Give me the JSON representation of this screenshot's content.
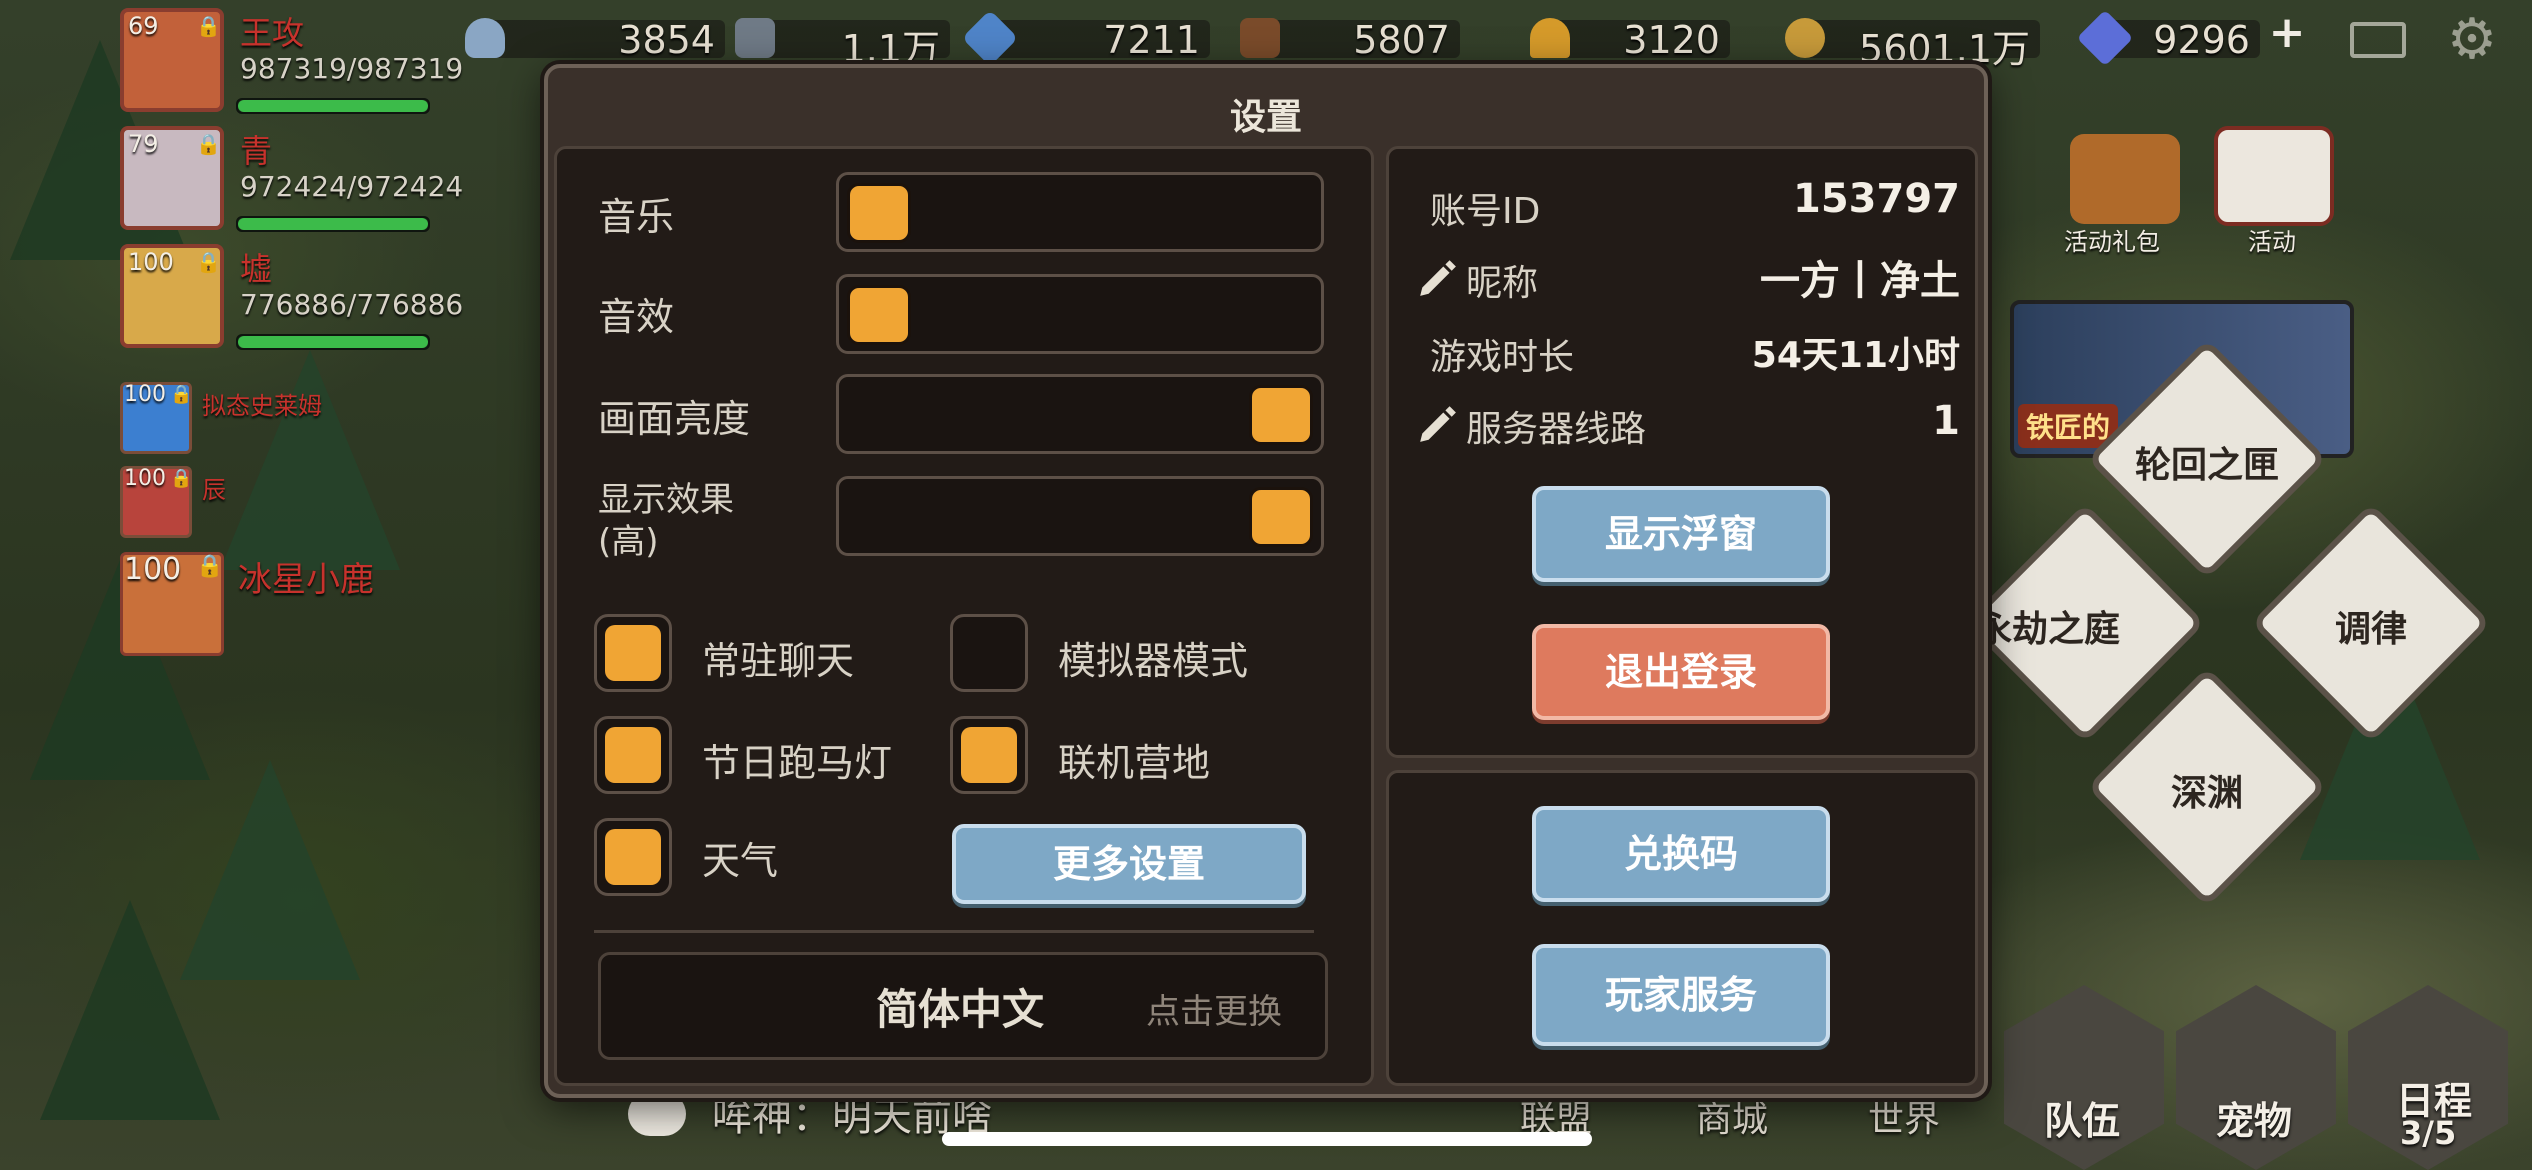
{
  "resources": [
    {
      "icon": "stone-icon",
      "value": "3854"
    },
    {
      "icon": "iron-icon",
      "value": "1.1万"
    },
    {
      "icon": "crystal-icon",
      "value": "7211"
    },
    {
      "icon": "wood-icon",
      "value": "5807"
    },
    {
      "icon": "wheat-icon",
      "value": "3120"
    },
    {
      "icon": "coin-icon",
      "value": "5601.1万"
    },
    {
      "icon": "diamond-gem-icon",
      "value": "9296"
    }
  ],
  "party": [
    {
      "level": "69",
      "name": "王攻",
      "hp": "987319/987319",
      "hp_fraction": 1.0
    },
    {
      "level": "79",
      "name": "青",
      "hp": "972424/972424",
      "hp_fraction": 1.0
    },
    {
      "level": "100",
      "name": "墟",
      "hp": "776886/776886",
      "hp_fraction": 1.0
    }
  ],
  "pets": [
    {
      "level": "100",
      "name": "拟态史莱姆"
    },
    {
      "level": "100",
      "name": "辰"
    },
    {
      "level": "100",
      "name": "冰星小鹿"
    }
  ],
  "side_menu": {
    "event_gift": "活动礼包",
    "event": "活动",
    "smith": "铁匠的",
    "diamonds": [
      "轮回之匣",
      "永劫之庭",
      "调律",
      "深渊"
    ]
  },
  "bottom": {
    "chat": "哞神：明天前啥",
    "tabs": [
      "联盟",
      "商城",
      "世界"
    ],
    "team": "队伍",
    "pet": "宠物",
    "schedule": "日程",
    "schedule_progress": "3/5"
  },
  "dialog": {
    "title": "设置",
    "music_label": "音乐",
    "music_level": 0,
    "sfx_label": "音效",
    "sfx_level": 0,
    "brightness_label": "画面亮度",
    "brightness_level": 1,
    "display_label": "显示效果",
    "display_sub": "(高)",
    "display_level": 1,
    "toggles": {
      "chat_label": "常驻聊天",
      "chat_on": true,
      "emulator_label": "模拟器模式",
      "emulator_on": false,
      "marquee_label": "节日跑马灯",
      "marquee_on": true,
      "camp_label": "联机营地",
      "camp_on": true,
      "weather_label": "天气",
      "weather_on": true
    },
    "more_settings": "更多设置",
    "language": "简体中文",
    "change_language": "点击更换",
    "account_id_label": "账号ID",
    "account_id": "153797",
    "nickname_label": "昵称",
    "nickname": "一方丨净土",
    "playtime_label": "游戏时长",
    "playtime": "54天11小时",
    "server_label": "服务器线路",
    "server": "1",
    "show_float": "显示浮窗",
    "logout": "退出登录",
    "redeem": "兑换码",
    "player_service": "玩家服务"
  }
}
